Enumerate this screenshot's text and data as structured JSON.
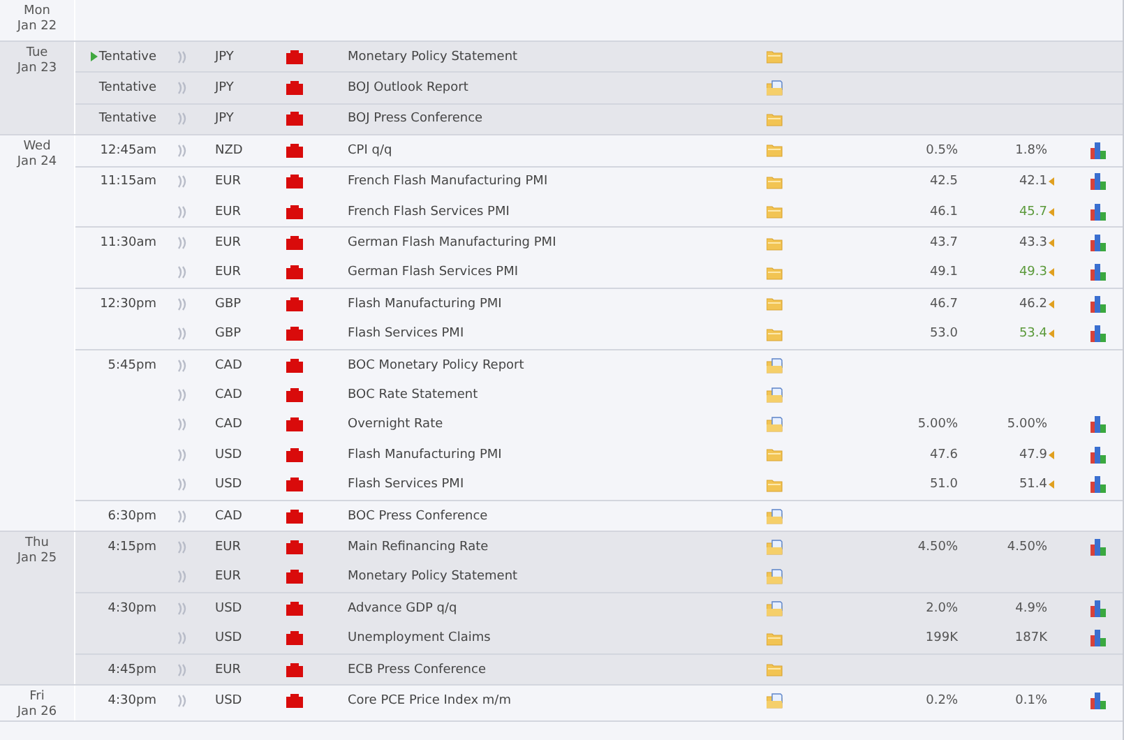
{
  "days": [
    {
      "weekday": "Mon",
      "date": "Jan 22"
    },
    {
      "weekday": "Tue",
      "date": "Jan 23",
      "groups": [
        {
          "time": "Tentative",
          "next": true,
          "events": [
            {
              "currency": "JPY",
              "title": "Monetary Policy Statement",
              "document": false
            }
          ]
        },
        {
          "time": "Tentative",
          "next": false,
          "events": [
            {
              "currency": "JPY",
              "title": "BOJ Outlook Report",
              "document": true
            }
          ]
        },
        {
          "time": "Tentative",
          "next": false,
          "events": [
            {
              "currency": "JPY",
              "title": "BOJ Press Conference",
              "document": false
            }
          ]
        }
      ]
    },
    {
      "weekday": "Wed",
      "date": "Jan 24",
      "groups": [
        {
          "time": "12:45am",
          "next": false,
          "events": [
            {
              "currency": "NZD",
              "title": "CPI q/q",
              "document": false,
              "forecast": "0.5%",
              "previous": "1.8%",
              "revised": false,
              "better": false
            }
          ]
        },
        {
          "time": "11:15am",
          "next": false,
          "events": [
            {
              "currency": "EUR",
              "title": "French Flash Manufacturing PMI",
              "document": false,
              "forecast": "42.5",
              "previous": "42.1",
              "revised": true,
              "better": false
            },
            {
              "currency": "EUR",
              "title": "French Flash Services PMI",
              "document": false,
              "forecast": "46.1",
              "previous": "45.7",
              "revised": true,
              "better": true
            }
          ]
        },
        {
          "time": "11:30am",
          "next": false,
          "events": [
            {
              "currency": "EUR",
              "title": "German Flash Manufacturing PMI",
              "document": false,
              "forecast": "43.7",
              "previous": "43.3",
              "revised": true,
              "better": false
            },
            {
              "currency": "EUR",
              "title": "German Flash Services PMI",
              "document": false,
              "forecast": "49.1",
              "previous": "49.3",
              "revised": true,
              "better": true
            }
          ]
        },
        {
          "time": "12:30pm",
          "next": false,
          "events": [
            {
              "currency": "GBP",
              "title": "Flash Manufacturing PMI",
              "document": false,
              "forecast": "46.7",
              "previous": "46.2",
              "revised": true,
              "better": false
            },
            {
              "currency": "GBP",
              "title": "Flash Services PMI",
              "document": false,
              "forecast": "53.0",
              "previous": "53.4",
              "revised": true,
              "better": true
            }
          ]
        },
        {
          "time": "5:45pm",
          "next": false,
          "events": [
            {
              "currency": "CAD",
              "title": "BOC Monetary Policy Report",
              "document": true
            },
            {
              "currency": "CAD",
              "title": "BOC Rate Statement",
              "document": true
            },
            {
              "currency": "CAD",
              "title": "Overnight Rate",
              "document": true,
              "forecast": "5.00%",
              "previous": "5.00%",
              "revised": false,
              "better": false
            },
            {
              "currency": "USD",
              "title": "Flash Manufacturing PMI",
              "document": false,
              "forecast": "47.6",
              "previous": "47.9",
              "revised": true,
              "better": false
            },
            {
              "currency": "USD",
              "title": "Flash Services PMI",
              "document": false,
              "forecast": "51.0",
              "previous": "51.4",
              "revised": true,
              "better": false
            }
          ]
        },
        {
          "time": "6:30pm",
          "next": false,
          "events": [
            {
              "currency": "CAD",
              "title": "BOC Press Conference",
              "document": true
            }
          ]
        }
      ]
    },
    {
      "weekday": "Thu",
      "date": "Jan 25",
      "groups": [
        {
          "time": "4:15pm",
          "next": false,
          "events": [
            {
              "currency": "EUR",
              "title": "Main Refinancing Rate",
              "document": true,
              "forecast": "4.50%",
              "previous": "4.50%",
              "revised": false,
              "better": false
            },
            {
              "currency": "EUR",
              "title": "Monetary Policy Statement",
              "document": true
            }
          ]
        },
        {
          "time": "4:30pm",
          "next": false,
          "events": [
            {
              "currency": "USD",
              "title": "Advance GDP q/q",
              "document": true,
              "forecast": "2.0%",
              "previous": "4.9%",
              "revised": false,
              "better": false
            },
            {
              "currency": "USD",
              "title": "Unemployment Claims",
              "document": false,
              "forecast": "199K",
              "previous": "187K",
              "revised": false,
              "better": false
            }
          ]
        },
        {
          "time": "4:45pm",
          "next": false,
          "events": [
            {
              "currency": "EUR",
              "title": "ECB Press Conference",
              "document": false
            }
          ]
        }
      ]
    },
    {
      "weekday": "Fri",
      "date": "Jan 26",
      "groups": [
        {
          "time": "4:30pm",
          "next": false,
          "events": [
            {
              "currency": "USD",
              "title": "Core PCE Price Index m/m",
              "document": true,
              "forecast": "0.2%",
              "previous": "0.1%",
              "revised": false,
              "better": false
            }
          ]
        }
      ]
    }
  ]
}
